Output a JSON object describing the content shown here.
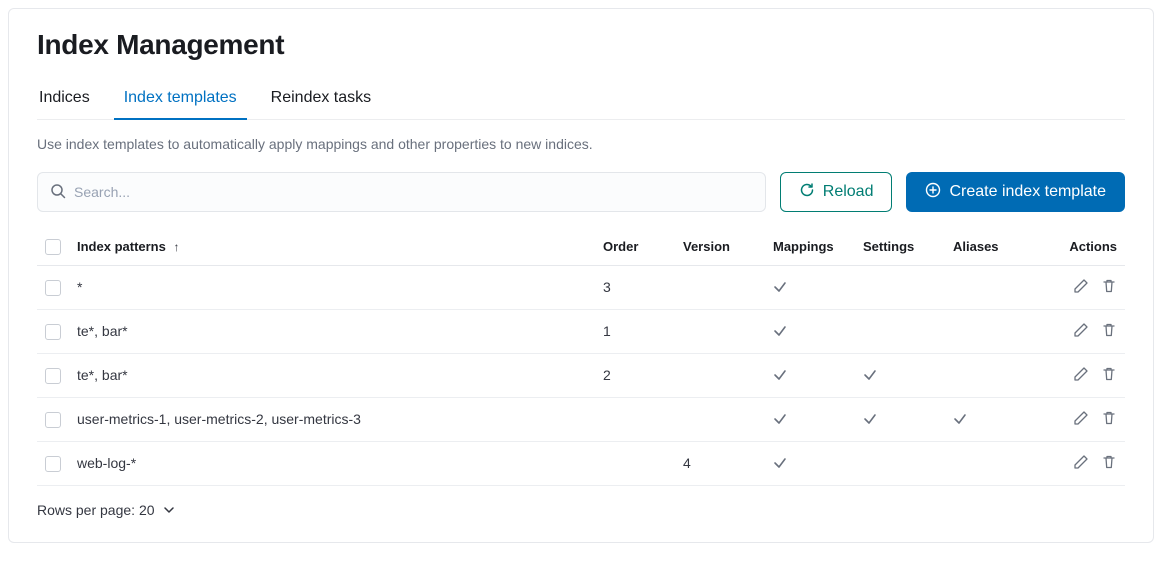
{
  "page": {
    "title": "Index Management",
    "description": "Use index templates to automatically apply mappings and other properties to new indices."
  },
  "tabs": [
    {
      "label": "Indices",
      "active": false
    },
    {
      "label": "Index templates",
      "active": true
    },
    {
      "label": "Reindex tasks",
      "active": false
    }
  ],
  "search": {
    "placeholder": "Search..."
  },
  "buttons": {
    "reload": "Reload",
    "create": "Create index template"
  },
  "columns": {
    "patterns": "Index patterns",
    "order": "Order",
    "version": "Version",
    "mappings": "Mappings",
    "settings": "Settings",
    "aliases": "Aliases",
    "actions": "Actions"
  },
  "rows": [
    {
      "patterns": "*",
      "order": "3",
      "version": "",
      "mappings": true,
      "settings": false,
      "aliases": false
    },
    {
      "patterns": "te*, bar*",
      "order": "1",
      "version": "",
      "mappings": true,
      "settings": false,
      "aliases": false
    },
    {
      "patterns": "te*, bar*",
      "order": "2",
      "version": "",
      "mappings": true,
      "settings": true,
      "aliases": false
    },
    {
      "patterns": "user-metrics-1, user-metrics-2, user-metrics-3",
      "order": "",
      "version": "",
      "mappings": true,
      "settings": true,
      "aliases": true
    },
    {
      "patterns": "web-log-*",
      "order": "",
      "version": "4",
      "mappings": true,
      "settings": false,
      "aliases": false
    }
  ],
  "pagination": {
    "label": "Rows per page: 20"
  }
}
